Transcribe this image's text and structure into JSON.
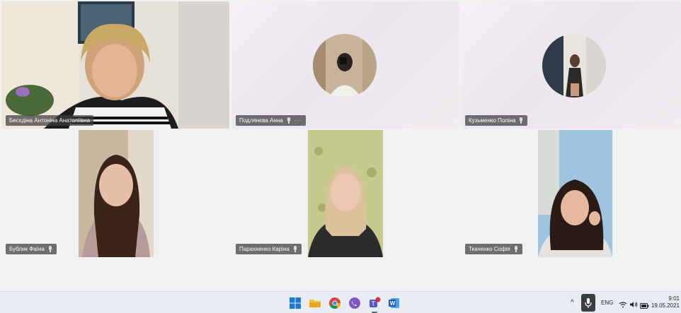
{
  "participants": [
    {
      "name": "Бесєдіна Антоніна Анатоліївна",
      "muted": false
    },
    {
      "name": "Подлянєва Анна",
      "muted": true,
      "more": "···"
    },
    {
      "name": "Кузьменко Поліна",
      "muted": true
    },
    {
      "name": "Бублик Фаїна",
      "muted": true
    },
    {
      "name": "Парахненко Каріна",
      "muted": true
    },
    {
      "name": "Ткаченко Софія",
      "muted": true
    }
  ],
  "taskbar": {
    "apps": [
      "windows-start-icon",
      "file-explorer-icon",
      "chrome-icon",
      "viber-icon",
      "teams-icon",
      "word-icon"
    ],
    "tray": {
      "chevron": "^",
      "language": "ENG",
      "time": "9:01",
      "date": "19.05.2021"
    }
  },
  "colors": {
    "nametag_bg": "#3c3c3c",
    "taskbar_bg": "#e9edf3",
    "tile_bg": "#ece6ee"
  }
}
